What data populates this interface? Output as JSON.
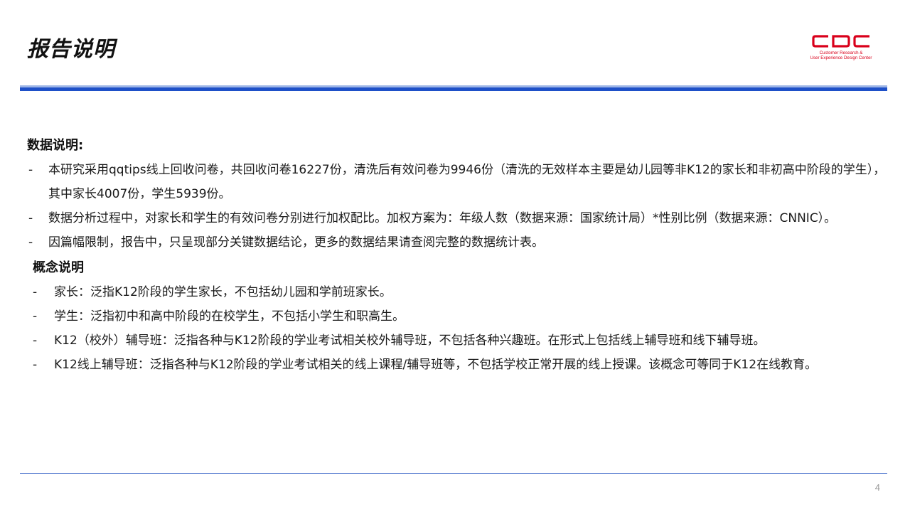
{
  "header": {
    "title": "报告说明",
    "logo": {
      "wordmark": "CDC",
      "line1": "Customer Research &",
      "line2": "User Experience Design Center",
      "color": "#d9001b"
    }
  },
  "data_section": {
    "heading": "数据说明:",
    "items": [
      "本研究采用qqtips线上回收问卷，共回收问卷16227份，清洗后有效问卷为9946份（清洗的无效样本主要是幼儿园等非K12的家长和非初高中阶段的学生），其中家长4007份，学生5939份。",
      "数据分析过程中，对家长和学生的有效问卷分别进行加权配比。加权方案为：年级人数（数据来源：国家统计局）*性别比例（数据来源：CNNIC）。",
      "因篇幅限制，报告中，只呈现部分关键数据结论，更多的数据结果请查阅完整的数据统计表。"
    ]
  },
  "concept_section": {
    "heading": "概念说明",
    "items": [
      "家长：泛指K12阶段的学生家长，不包括幼儿园和学前班家长。",
      "学生：泛指初中和高中阶段的在校学生，不包括小学生和职高生。",
      "K12（校外）辅导班：泛指各种与K12阶段的学业考试相关校外辅导班，不包括各种兴趣班。在形式上包括线上辅导班和线下辅导班。",
      "K12线上辅导班：泛指各种与K12阶段的学业考试相关的线上课程/辅导班等，不包括学校正常开展的线上授课。该概念可等同于K12在线教育。"
    ]
  },
  "bullet": "-",
  "footer": {
    "page_number": "4"
  },
  "colors": {
    "accent_blue": "#1e50c8",
    "brand_red": "#d9001b"
  }
}
